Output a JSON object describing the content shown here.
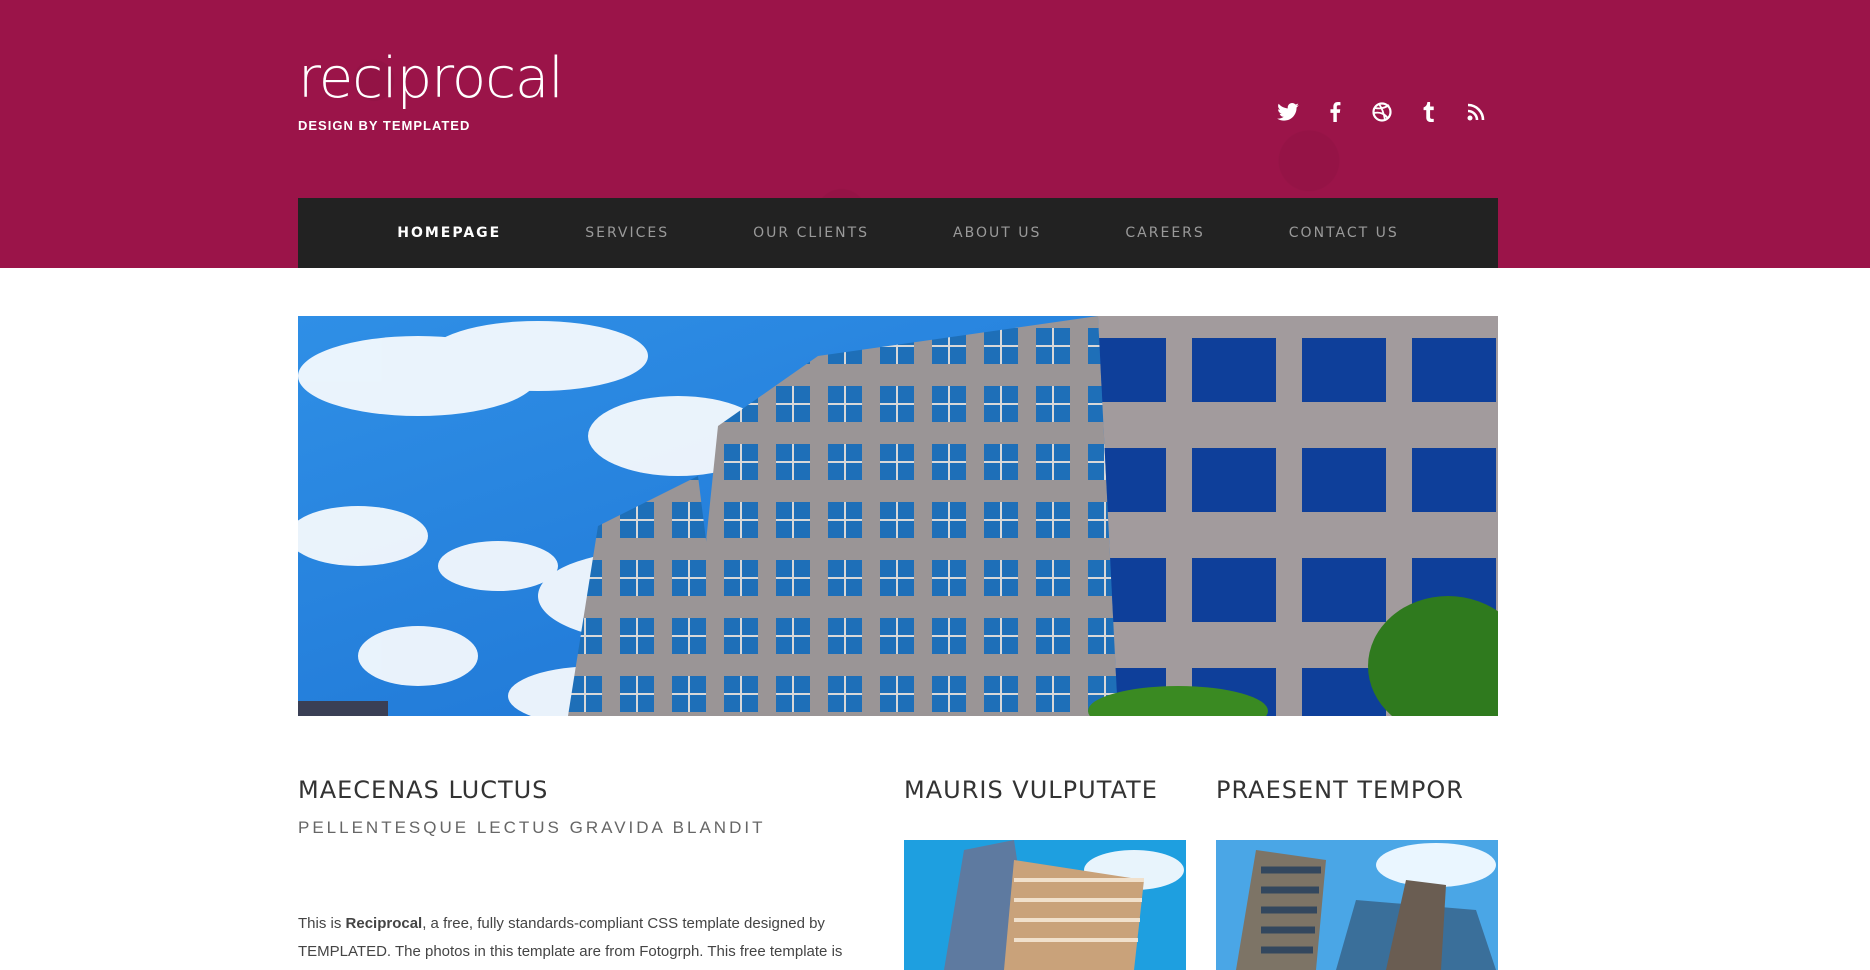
{
  "site": {
    "logo": "reciprocal",
    "tagline": "DESIGN BY TEMPLATED"
  },
  "social": [
    {
      "name": "twitter-icon",
      "glyph": "t"
    },
    {
      "name": "facebook-icon",
      "glyph": "f"
    },
    {
      "name": "dribbble-icon",
      "glyph": "◎"
    },
    {
      "name": "tumblr-icon",
      "glyph": "t"
    },
    {
      "name": "rss-icon",
      "glyph": "◔"
    }
  ],
  "nav": {
    "items": [
      {
        "label": "HOMEPAGE",
        "active": true
      },
      {
        "label": "SERVICES"
      },
      {
        "label": "OUR CLIENTS"
      },
      {
        "label": "ABOUT US"
      },
      {
        "label": "CAREERS"
      },
      {
        "label": "CONTACT US"
      }
    ]
  },
  "main": {
    "title": "MAECENAS LUCTUS",
    "subtitle": "PELLENTESQUE LECTUS GRAVIDA BLANDIT",
    "text_prefix": "This is ",
    "text_bold": "Reciprocal",
    "text_suffix": ", a free, fully standards-compliant CSS template designed by TEMPLATED. The photos in this template are from Fotogrph. This free template is"
  },
  "sidebar": {
    "col1_title": "MAURIS VULPUTATE",
    "col2_title": "PRAESENT TEMPOR"
  },
  "colors": {
    "header_bg": "#9b1449",
    "nav_bg": "#222222"
  }
}
